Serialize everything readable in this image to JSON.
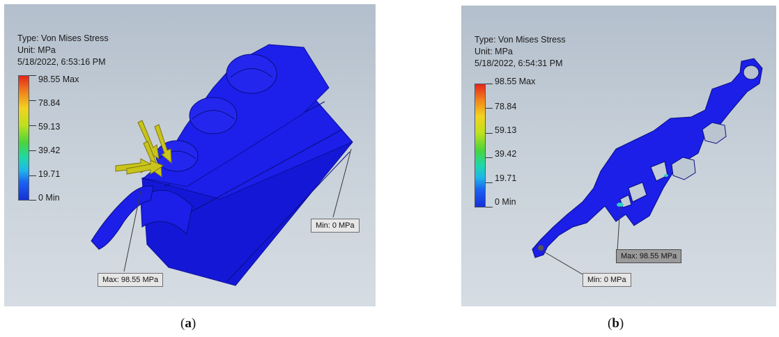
{
  "panels": [
    {
      "info": {
        "type": "Type: Von Mises Stress",
        "unit": "Unit: MPa",
        "timestamp": "5/18/2022, 6:53:16 PM"
      },
      "scale": [
        "98.55 Max",
        "78.84",
        "59.13",
        "39.42",
        "19.71",
        "0 Min"
      ],
      "probe_min": "Min: 0 MPa",
      "probe_max": "Max: 98.55 MPa",
      "caption_letter": "a"
    },
    {
      "info": {
        "type": "Type: Von Mises Stress",
        "unit": "Unit: MPa",
        "timestamp": "5/18/2022, 6:54:31 PM"
      },
      "scale": [
        "98.55 Max",
        "78.84",
        "59.13",
        "39.42",
        "19.71",
        "0 Min"
      ],
      "probe_min": "Min: 0 MPa",
      "probe_max": "Max: 98.55 MPa",
      "caption_letter": "b"
    }
  ],
  "colors": {
    "model_fill": "#1a1de6",
    "load_arrow": "#c8c21a",
    "background": "#c4ccd6"
  }
}
